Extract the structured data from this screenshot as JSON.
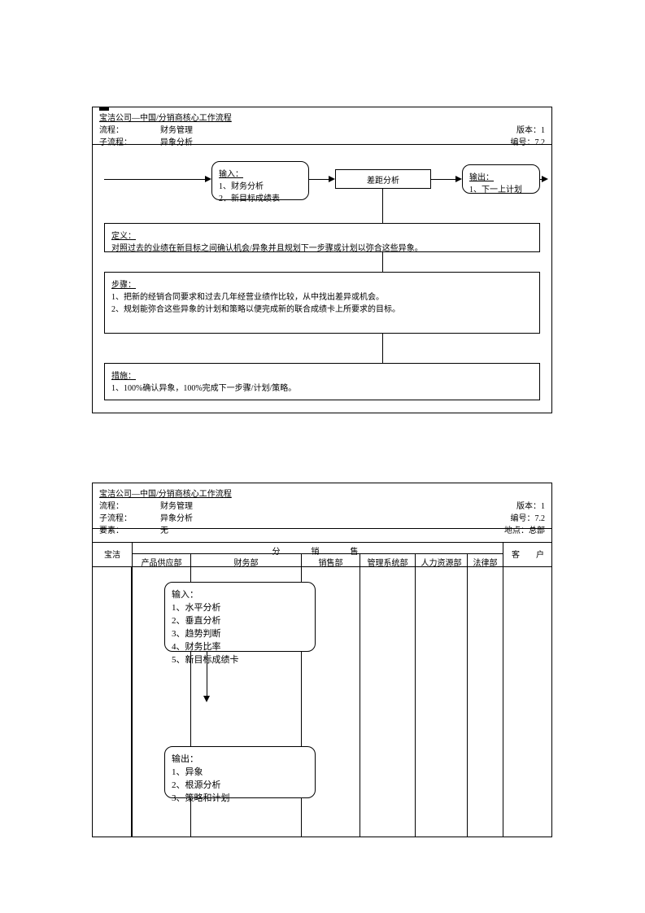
{
  "diagram1": {
    "header": {
      "title": "宝洁公司—中国/分销商核心工作流程",
      "process_label": "流程：",
      "process_value": "财务管理",
      "subprocess_label": "子流程：",
      "subprocess_value": "异象分析",
      "version": "版本：1",
      "number": "编号：7.2"
    },
    "input": {
      "title": "输入：",
      "line1": "1、财务分析",
      "line2": "2、新目标成绩表"
    },
    "center_box": "差距分析",
    "output": {
      "title": "输出：",
      "line1": "1、下一上计划"
    },
    "definition": {
      "title": "定义：",
      "text": "对照过去的业绩在新目标之间确认机会/异象并且规划下一步骤或计划以弥合这些异象。"
    },
    "steps": {
      "title": "步骤：",
      "line1": "1、把新的经销合同要求和过去几年经营业绩作比较，从中找出差异或机会。",
      "line2": "2、规划能弥合这些异象的计划和策略以便完成新的联合成绩卡上所要求的目标。"
    },
    "measures": {
      "title": "措施：",
      "line1": "1、100%确认异象，100%完成下一步骤/计划/策略。"
    }
  },
  "diagram2": {
    "header": {
      "title": "宝洁公司—中国/分销商核心工作流程",
      "process_label": "流程：",
      "process_value": "财务管理",
      "subprocess_label": "子流程：",
      "subprocess_value": "异象分析",
      "element_label": "要素：",
      "element_value": "无",
      "version": "版本：1",
      "number": "编号：7.2",
      "location": "地点：总部"
    },
    "swimlanes": {
      "left": "宝洁",
      "group": "分　　销　　售",
      "cols": [
        "产品供应部",
        "财务部",
        "销售部",
        "管理系统部",
        "人力资源部",
        "法律部"
      ],
      "right": "客　　户"
    },
    "input_box": {
      "title": "输入：",
      "line1": "1、水平分析",
      "line2": "2、垂直分析",
      "line3": "3、趋势判断",
      "line4": "4、财务比率",
      "line5": "5、新目标成绩卡"
    },
    "output_box": {
      "title": "输出：",
      "line1": "1、异象",
      "line2": "2、根源分析",
      "line3": "3、策略和计划"
    }
  }
}
